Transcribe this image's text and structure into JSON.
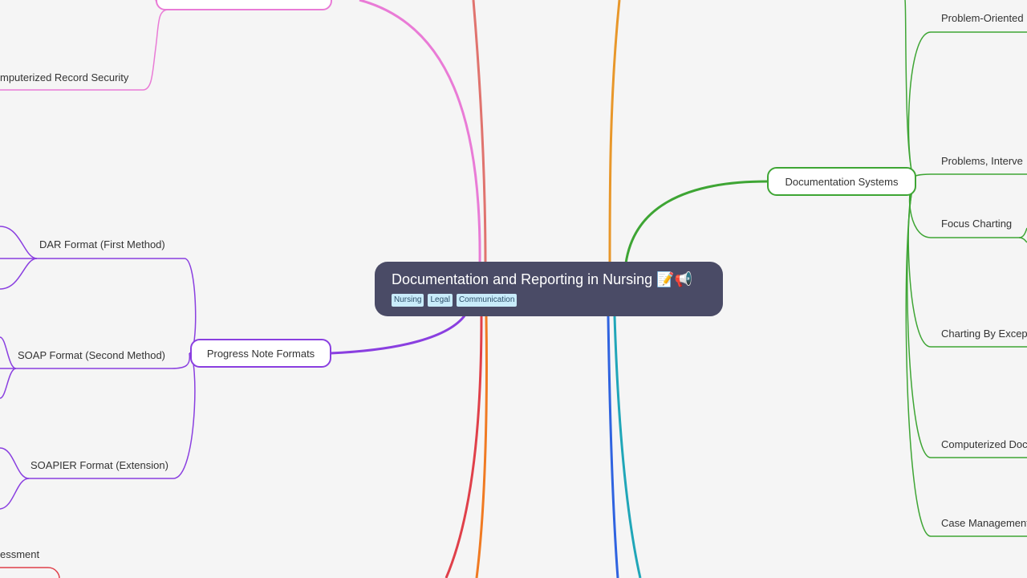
{
  "root": {
    "title": "Documentation and Reporting in Nursing",
    "emoji": "📝📢",
    "tags": [
      "Nursing",
      "Legal",
      "Communication"
    ]
  },
  "left": {
    "record_security": "mputerized Record Security",
    "progress_note_formats": "Progress Note Formats",
    "dar_format": "DAR Format (First Method)",
    "soap_format": "SOAP Format (Second Method)",
    "soapier_format": "SOAPIER Format (Extension)",
    "assessment_fragment": "essment"
  },
  "right": {
    "documentation_systems": "Documentation Systems",
    "problem_oriented": "Problem-Oriented",
    "problems_interventions": "Problems, Interve",
    "focus_charting": "Focus Charting",
    "charting_by_exception": "Charting By Excep",
    "computerized_doc": "Computerized Doc",
    "case_management": "Case Management"
  },
  "colors": {
    "pink": "#e97bd6",
    "salmon": "#e0736e",
    "purple": "#8a3fe0",
    "red": "#e0404a",
    "orange": "#f07a22",
    "amber": "#e8972a",
    "green": "#3ea534",
    "blue": "#2f63e0",
    "teal": "#20a6b8",
    "root_bg": "#4a4b66"
  }
}
